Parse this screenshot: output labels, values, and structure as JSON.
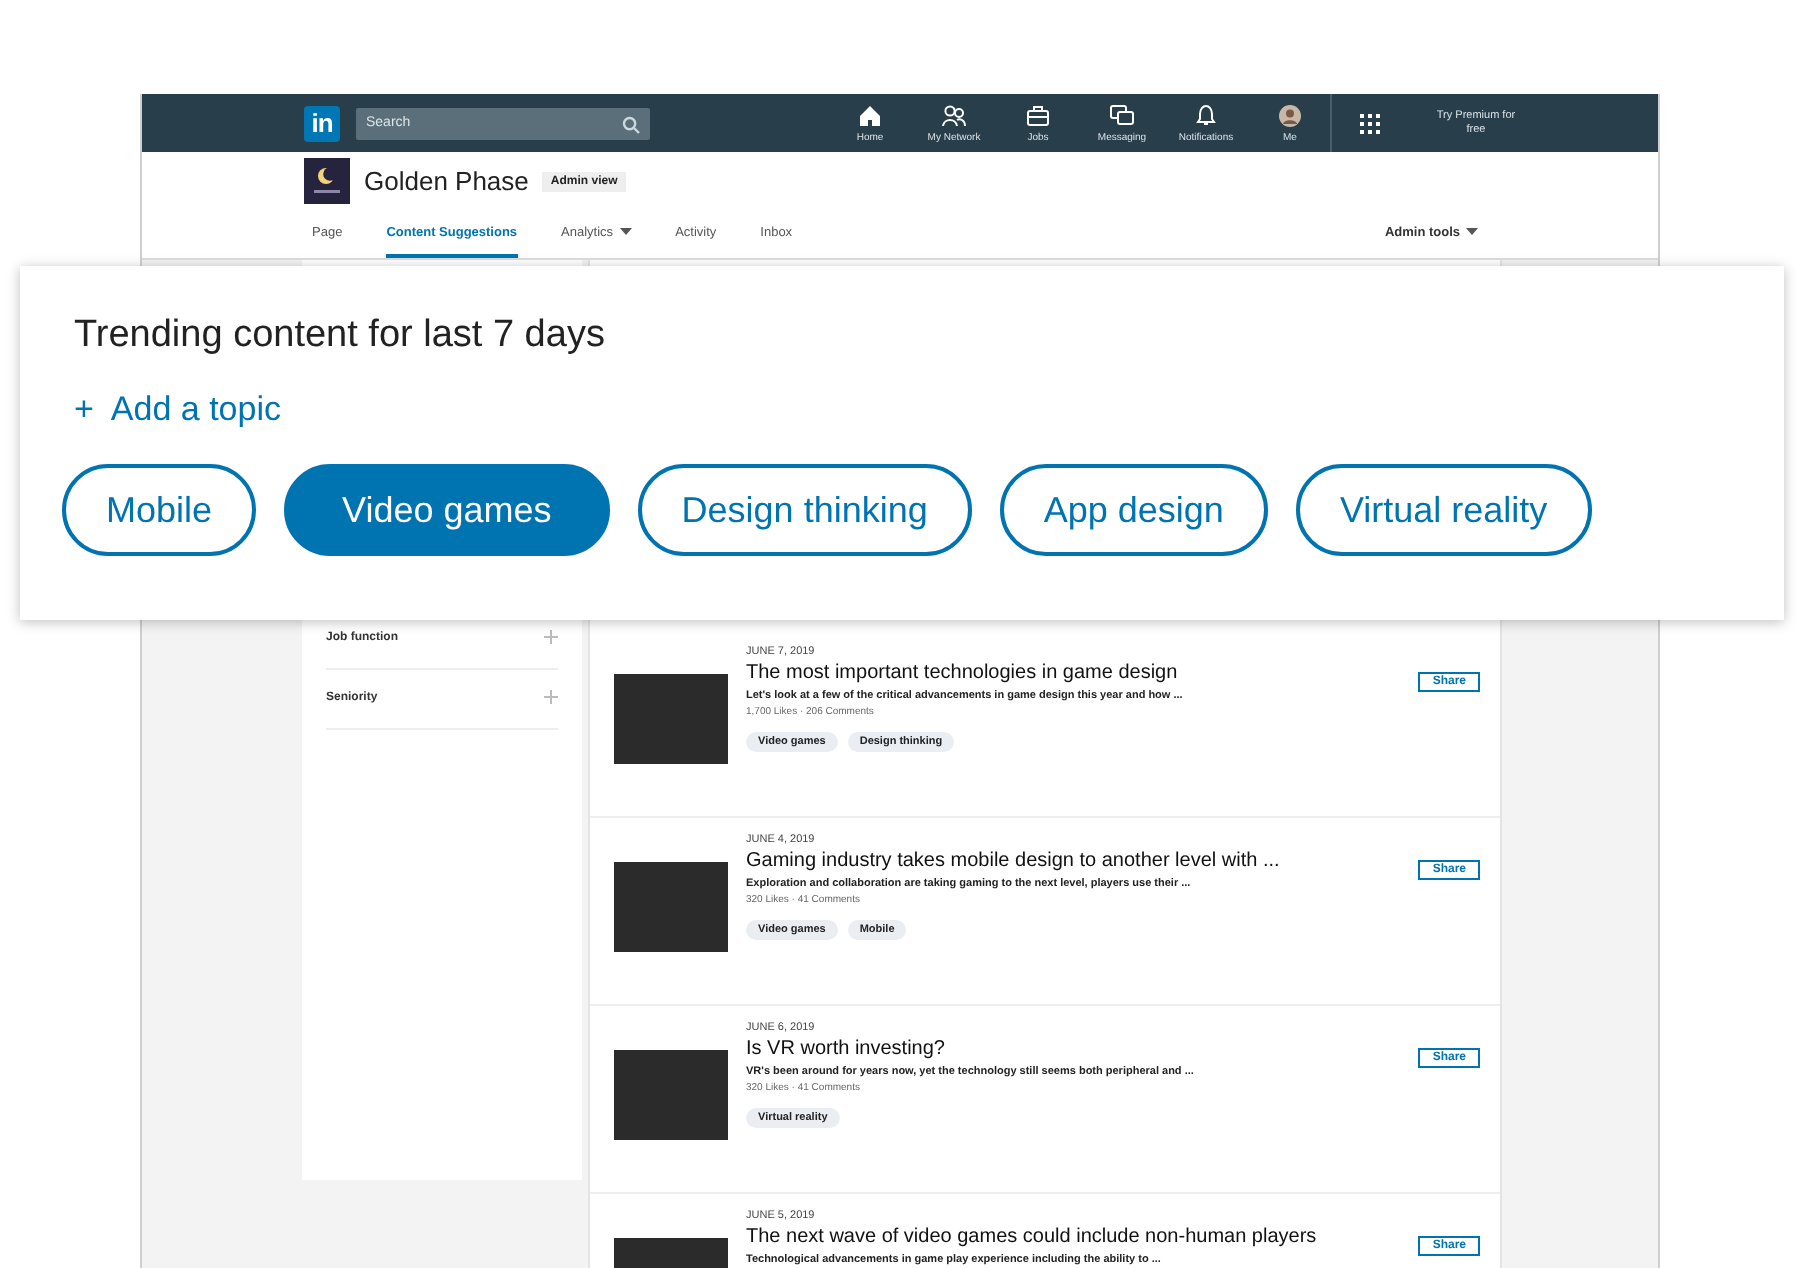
{
  "nav": {
    "logo": "in",
    "search": {
      "placeholder": "Search"
    },
    "items": [
      {
        "kind": "home",
        "label": "Home"
      },
      {
        "kind": "network",
        "label": "My Network"
      },
      {
        "kind": "jobs",
        "label": "Jobs"
      },
      {
        "kind": "messaging",
        "label": "Messaging"
      },
      {
        "kind": "notifications",
        "label": "Notifications"
      },
      {
        "kind": "me",
        "label": "Me"
      }
    ],
    "premium": "Try Premium for free"
  },
  "company": {
    "name": "Golden Phase",
    "badge": "Admin view"
  },
  "tabs": [
    {
      "label": "Page",
      "selected": false,
      "dropdown": false
    },
    {
      "label": "Content Suggestions",
      "selected": true,
      "dropdown": false
    },
    {
      "label": "Analytics",
      "selected": false,
      "dropdown": true
    },
    {
      "label": "Activity",
      "selected": false,
      "dropdown": false
    },
    {
      "label": "Inbox",
      "selected": false,
      "dropdown": false
    }
  ],
  "admin_tools": "Admin tools",
  "trending": {
    "title": "Trending content for last 7 days",
    "add_symbol": "+",
    "add_topic": "Add a topic",
    "topics": [
      {
        "label": "Mobile",
        "selected": false
      },
      {
        "label": "Video games",
        "selected": true
      },
      {
        "label": "Design thinking",
        "selected": false
      },
      {
        "label": "App design",
        "selected": false
      },
      {
        "label": "Virtual reality",
        "selected": false
      }
    ]
  },
  "sidebar": {
    "filters": [
      {
        "label": "Job function"
      },
      {
        "label": "Seniority"
      }
    ]
  },
  "posts": [
    {
      "date": "JUNE 7, 2019",
      "title": "The most important technologies in game design",
      "summary": "Let's look at a few of the critical advancements in game design this year and how ...",
      "stats": "1,700 Likes · 206 Comments",
      "tags": [
        "Video games",
        "Design thinking"
      ],
      "share": "Share"
    },
    {
      "date": "JUNE 4, 2019",
      "title": "Gaming industry takes mobile design to another level with ...",
      "summary": "Exploration and collaboration are taking gaming to the next level, players use their ...",
      "stats": "320 Likes · 41 Comments",
      "tags": [
        "Video games",
        "Mobile"
      ],
      "share": "Share"
    },
    {
      "date": "JUNE 6, 2019",
      "title": "Is VR worth investing?",
      "summary": "VR's been around for years now, yet the technology still seems both peripheral and ...",
      "stats": "320 Likes · 41 Comments",
      "tags": [
        "Virtual reality"
      ],
      "share": "Share"
    },
    {
      "date": "JUNE 5, 2019",
      "title": "The next wave of video games could include non-human players",
      "summary": "Technological advancements in game play experience including the ability to ...",
      "share": "Share"
    }
  ]
}
